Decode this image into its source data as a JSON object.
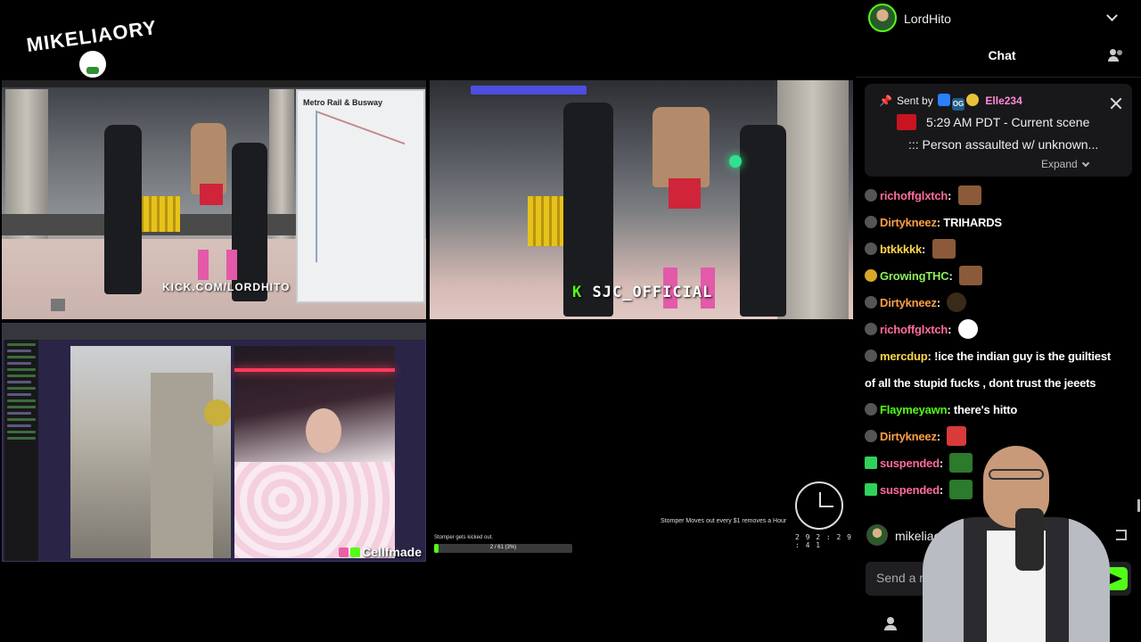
{
  "stream": {
    "logo_text": "MIKELIAORY",
    "feed_a_watermark": "KICK.COM/LORDHITO",
    "feed_a_sign": "Metro Rail & Busway",
    "feed_b_watermark": "SJC_OFFICIAL",
    "screen_watermark": "Cellfmade",
    "goal_label": "Stomper gets kicked out.",
    "goal_progress_text": "2 / 61 (3%)",
    "goal_progress": 0.03,
    "rule_text": "Stomper Moves out every $1 removes a Hour",
    "countdown": "2 9 2 : 2 9 : 4 1"
  },
  "chat": {
    "channel_name": "LordHito",
    "title": "Chat",
    "pinned": {
      "sent_by_label": "Sent by",
      "sender": "Elle234",
      "line1": "5:29 AM PDT - Current scene",
      "line2": "::: Person assaulted w/ unknown...",
      "expand_label": "Expand"
    },
    "messages": [
      {
        "user": "richoffglxtch",
        "color": "#ff6b9d",
        "text": "",
        "emote": "brown"
      },
      {
        "user": "Dirtykneez",
        "color": "#ff9f43",
        "text": "TRIHARDS",
        "emote": ""
      },
      {
        "user": "btkkkkk",
        "color": "#ffd54a",
        "text": "",
        "emote": "brown"
      },
      {
        "user": "GrowingTHC",
        "color": "#8ef05a",
        "text": "",
        "emote": "brown"
      },
      {
        "user": "Dirtykneez",
        "color": "#ff9f43",
        "text": "",
        "emote": "dark"
      },
      {
        "user": "richoffglxtch",
        "color": "#ff6b9d",
        "text": "",
        "emote": "white"
      },
      {
        "user": "mercdup",
        "color": "#ffd54a",
        "text": "!ice the indian guy is the guiltiest"
      },
      {
        "user": "",
        "color": "#ffffff",
        "text": "of all the stupid fucks , dont trust the jeeets"
      },
      {
        "user": "Flaymeyawn",
        "color": "#53fc18",
        "text": "there's hitto"
      },
      {
        "user": "Dirtykneez",
        "color": "#ff9f43",
        "text": "",
        "emote": "xmas"
      },
      {
        "user": "suspended",
        "color": "#ff6b9d",
        "text": "",
        "emote": "smash"
      },
      {
        "user": "suspended",
        "color": "#ff6b9d",
        "text": "",
        "emote": "smash"
      }
    ],
    "current_user": "mikeliaory",
    "input_placeholder": "Send a message"
  },
  "icons": {
    "pin": "pin-icon",
    "close": "close-icon",
    "users": "users-icon",
    "send": "send-icon",
    "logout": "logout-icon",
    "add_user": "add-user-icon",
    "chevron": "chevron-down-icon"
  },
  "colors": {
    "kick_green": "#53fc18",
    "sender_pink": "#ff8ad8",
    "panel_bg": "#18181b"
  }
}
